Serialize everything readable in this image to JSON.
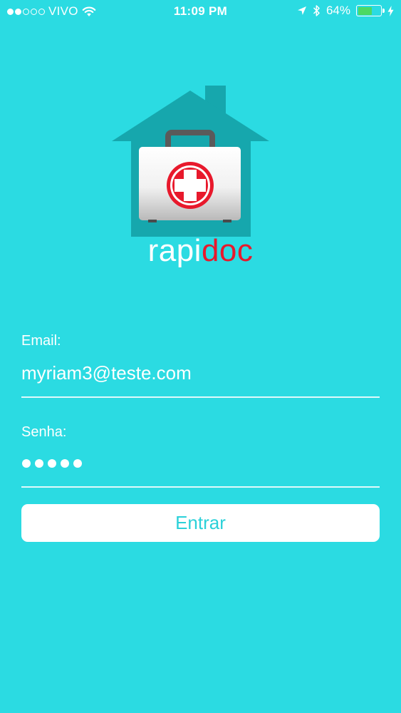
{
  "status_bar": {
    "signal_full": 2,
    "signal_total": 5,
    "carrier": "VIVO",
    "wifi_icon": "wifi-icon",
    "time": "11:09 PM",
    "location_icon": "location-arrow-icon",
    "bluetooth_icon": "bluetooth-icon",
    "battery_percent": "64%",
    "battery_level": 0.64,
    "charging_icon": "charging-bolt-icon"
  },
  "logo": {
    "icon": "house-medical-kit-icon",
    "wordmark_part1": "rapi",
    "wordmark_part2": "doc"
  },
  "form": {
    "email_label": "Email:",
    "email_value": "myriam3@teste.com",
    "password_label": "Senha:",
    "password_length": 5,
    "submit_label": "Entrar"
  },
  "colors": {
    "background": "#2bdbe2",
    "brand_red": "#e8192c",
    "house_teal": "#16a7ad",
    "button_text": "#2bd1d9",
    "battery_green": "#4cd964"
  }
}
